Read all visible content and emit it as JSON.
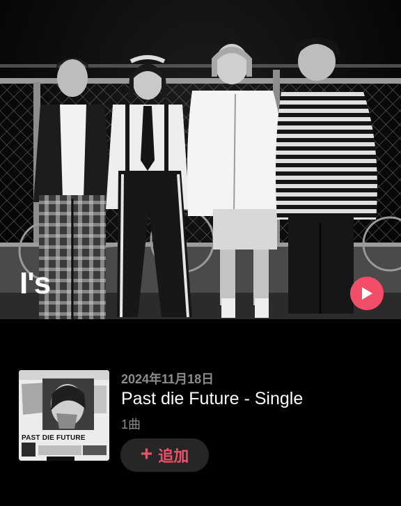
{
  "artist": {
    "name": "I's"
  },
  "hero": {
    "play_icon": "play-icon"
  },
  "release": {
    "date": "2024年11月18日",
    "title": "Past die Future - Single",
    "track_count": "1曲",
    "artwork_text": "PAST DIE FUTURE",
    "add_icon": "plus-icon",
    "add_label": "追加"
  },
  "colors": {
    "accent": "#f34e69",
    "background": "#000000",
    "secondary_text": "#8c8c8c",
    "button_bg": "#262626"
  }
}
